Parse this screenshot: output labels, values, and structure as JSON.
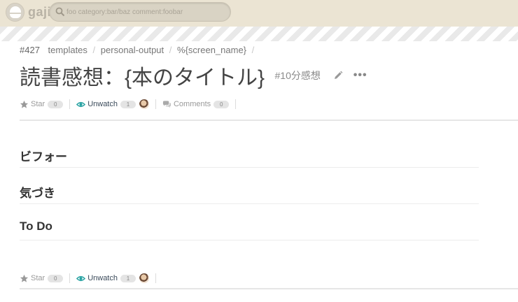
{
  "header": {
    "brand": "gaji",
    "search_placeholder": "foo category:bar/baz comment:foobar"
  },
  "breadcrumb": {
    "number": "#427",
    "items": [
      "templates",
      "personal-output",
      "%{screen_name}"
    ],
    "separator": "/"
  },
  "post": {
    "title": "読書感想：{本のタイトル}",
    "tag": "#10分感想"
  },
  "actions_top": {
    "star_label": "Star",
    "star_count": "0",
    "unwatch_label": "Unwatch",
    "watch_count": "1",
    "comments_label": "Comments",
    "comments_count": "0"
  },
  "sections": [
    "ビフォー",
    "気づき",
    "To Do"
  ],
  "actions_bottom": {
    "star_label": "Star",
    "star_count": "0",
    "unwatch_label": "Unwatch",
    "watch_count": "1"
  },
  "colors": {
    "topbar": "#ebe4d3",
    "watch_icon": "#2aa3a3"
  }
}
